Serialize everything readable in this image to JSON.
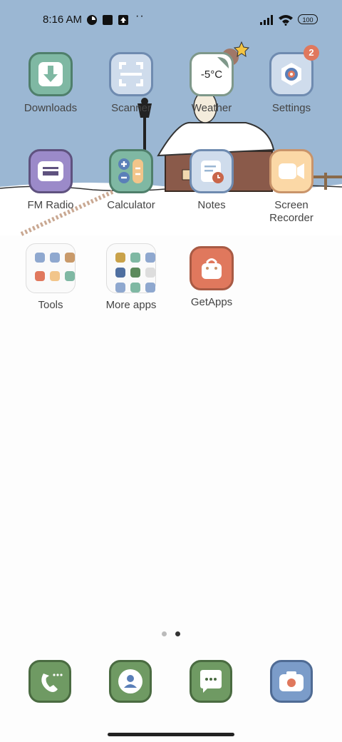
{
  "status_bar": {
    "time": "8:16 AM",
    "more_indicator": "··",
    "battery_level": "100"
  },
  "apps_row1": [
    {
      "name": "downloads-app",
      "label": "Downloads",
      "icon": "download-arrow-icon",
      "bg": "#7fb8a3",
      "border": "#4f7f6b"
    },
    {
      "name": "scanner-app",
      "label": "Scanner",
      "icon": "scan-frame-icon",
      "bg": "#cfdcec",
      "border": "#6f8bb0"
    },
    {
      "name": "weather-app",
      "label": "Weather",
      "icon": "weather-temperature-icon",
      "temperature": "-5°C",
      "bg": "#ffffff",
      "border": "#7e988a"
    },
    {
      "name": "settings-app",
      "label": "Settings",
      "icon": "gear-target-icon",
      "badge": "2",
      "bg": "#cfdcec",
      "border": "#6f8bb0"
    }
  ],
  "apps_row2": [
    {
      "name": "fm-radio-app",
      "label": "FM Radio",
      "icon": "radio-icon",
      "bg": "#9b8ac9",
      "border": "#5f527f"
    },
    {
      "name": "calculator-app",
      "label": "Calculator",
      "icon": "calculator-icon",
      "bg": "#7fb8a3",
      "border": "#4f7f6b"
    },
    {
      "name": "notes-app",
      "label": "Notes",
      "icon": "note-clock-icon",
      "bg": "#cfdcec",
      "border": "#6f8bb0"
    },
    {
      "name": "screen-recorder-app",
      "label": "Screen\nRecorder",
      "label_line1": "Screen",
      "label_line2": "Recorder",
      "icon": "video-camera-icon",
      "bg": "#fbd8a6",
      "border": "#c9946a"
    }
  ],
  "folders": [
    {
      "name": "tools-folder",
      "label": "Tools",
      "colors": [
        "#8fa8cf",
        "#8fa8cf",
        "#c99a6a",
        "#e0785d",
        "#f2c58a",
        "#7fb8a3"
      ]
    },
    {
      "name": "more-apps-folder",
      "label": "More apps",
      "colors": [
        "#c9a24a",
        "#7fb8a3",
        "#8fa8cf",
        "#4f6fa0",
        "#5c8a5c",
        "#dddddd",
        "#8fa8cf",
        "#7fb8a3",
        "#8fa8cf"
      ]
    }
  ],
  "getapps": {
    "label": "GetApps",
    "icon": "shopping-bag-icon",
    "bg": "#e0785d",
    "border": "#a85a44"
  },
  "pager": {
    "active_page": 2,
    "page_count": 2
  },
  "dock": [
    {
      "name": "phone-app",
      "icon": "phone-icon",
      "bg": "#6f9a63",
      "border": "#4a6b41"
    },
    {
      "name": "contacts-app",
      "icon": "contact-person-icon",
      "bg": "#6f9a63",
      "border": "#4a6b41"
    },
    {
      "name": "messages-app",
      "icon": "message-bubble-icon",
      "bg": "#6f9a63",
      "border": "#4a6b41"
    },
    {
      "name": "camera-app",
      "icon": "camera-icon",
      "bg": "#7b9cc9",
      "border": "#4f6b94"
    }
  ]
}
